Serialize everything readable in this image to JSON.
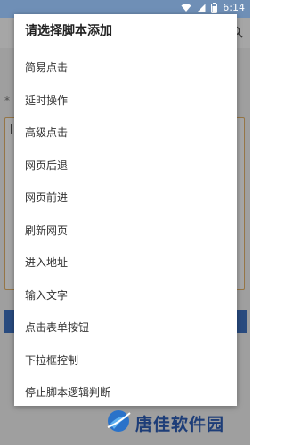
{
  "status_bar": {
    "time": "6:14",
    "icons": [
      "wifi-icon",
      "signal-icon",
      "battery-icon"
    ],
    "color": "#6f8fb6"
  },
  "background": {
    "asterisk_label": "*",
    "accent": "#e5b46b",
    "button_color": "#3f74c4"
  },
  "dialog": {
    "title": "请选择脚本添加",
    "options": [
      {
        "label": "简易点击"
      },
      {
        "label": "延时操作"
      },
      {
        "label": "高级点击"
      },
      {
        "label": "网页后退"
      },
      {
        "label": "网页前进"
      },
      {
        "label": "刷新网页"
      },
      {
        "label": "进入地址"
      },
      {
        "label": "输入文字"
      },
      {
        "label": "点击表单按钮"
      },
      {
        "label": "下拉框控制"
      },
      {
        "label": "停止脚本逻辑判断"
      }
    ]
  },
  "watermark": {
    "text": "唐佳软件园",
    "logo_icon": "globe-logo-icon"
  }
}
